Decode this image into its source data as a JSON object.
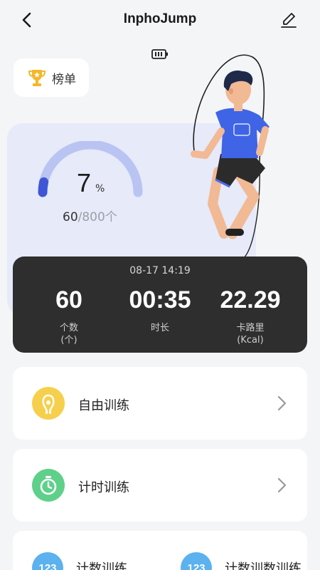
{
  "header": {
    "title": "InphoJump"
  },
  "rank": {
    "label": "榜单"
  },
  "progress": {
    "percent_value": "7",
    "percent_unit": "%",
    "fraction": 0.07,
    "count": "60",
    "total": "/800个"
  },
  "session": {
    "datetime": "08-17 14:19",
    "stats": [
      {
        "value": "60",
        "label": "个数",
        "sub": "(个)"
      },
      {
        "value": "00:35",
        "label": "时长",
        "sub": ""
      },
      {
        "value": "22.29",
        "label": "卡路里",
        "sub": "(Kcal)"
      }
    ]
  },
  "modes": [
    {
      "label": "自由训练",
      "icon": "jump-rope-icon",
      "color": "#f6cf4c"
    },
    {
      "label": "计时训练",
      "icon": "stopwatch-icon",
      "color": "#5fd08a"
    }
  ],
  "bottom": [
    {
      "badge": "123",
      "label": "计数训练"
    },
    {
      "badge": "123",
      "label": "计数训数训练"
    }
  ],
  "colors": {
    "accent_blue": "#3f57d6",
    "gauge_track": "#b9c4f2",
    "card_dark": "#2e2e2e"
  }
}
